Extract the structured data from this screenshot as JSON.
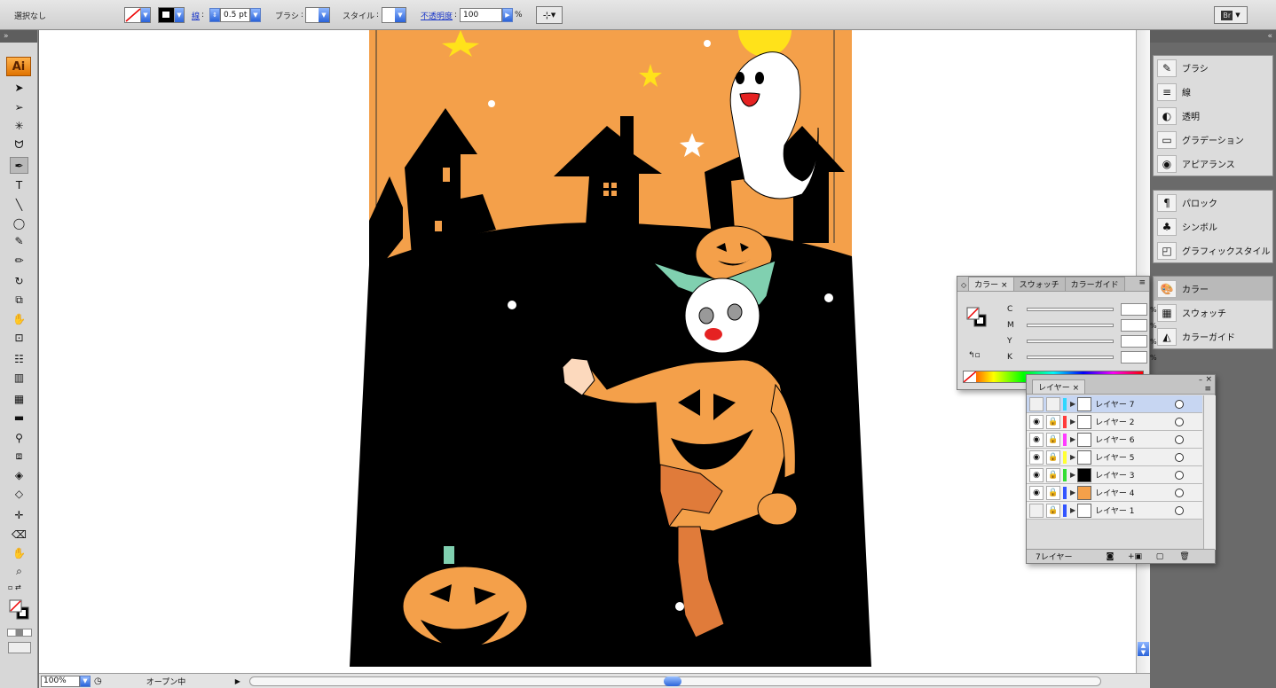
{
  "control_bar": {
    "selection_status": "選択なし",
    "stroke_label": "線",
    "stroke_weight": "0.5 pt",
    "brush_label": "ブラシ",
    "style_label": "スタイル",
    "opacity_label": "不透明度",
    "opacity_value": "100",
    "opacity_unit": "%",
    "bridge_label": "Br"
  },
  "toolbox": {
    "logo": "Ai",
    "tools": [
      {
        "icon": "selection-tool-icon",
        "glyph": "➤"
      },
      {
        "icon": "direct-selection-tool-icon",
        "glyph": "➢"
      },
      {
        "icon": "magic-wand-icon",
        "glyph": "✳"
      },
      {
        "icon": "lasso-icon",
        "glyph": "ᗢ"
      },
      {
        "icon": "pen-tool-icon",
        "glyph": "✒"
      },
      {
        "icon": "type-tool-icon",
        "glyph": "T"
      },
      {
        "icon": "line-tool-icon",
        "glyph": "╲"
      },
      {
        "icon": "ellipse-tool-icon",
        "glyph": "◯"
      },
      {
        "icon": "paintbrush-icon",
        "glyph": "✎"
      },
      {
        "icon": "pencil-icon",
        "glyph": "✏"
      },
      {
        "icon": "rotate-tool-icon",
        "glyph": "↻"
      },
      {
        "icon": "scale-tool-icon",
        "glyph": "⧉"
      },
      {
        "icon": "warp-tool-icon",
        "glyph": "✋"
      },
      {
        "icon": "free-transform-icon",
        "glyph": "⊡"
      },
      {
        "icon": "symbol-sprayer-icon",
        "glyph": "☷"
      },
      {
        "icon": "column-graph-icon",
        "glyph": "▥"
      },
      {
        "icon": "mesh-tool-icon",
        "glyph": "▦"
      },
      {
        "icon": "gradient-tool-icon",
        "glyph": "▬"
      },
      {
        "icon": "eyedropper-icon",
        "glyph": "⚲"
      },
      {
        "icon": "blend-tool-icon",
        "glyph": "⧈"
      },
      {
        "icon": "live-paint-bucket-icon",
        "glyph": "◈"
      },
      {
        "icon": "live-paint-selection-icon",
        "glyph": "◇"
      },
      {
        "icon": "slice-tool-icon",
        "glyph": "✛"
      },
      {
        "icon": "eraser-icon",
        "glyph": "⌫"
      },
      {
        "icon": "hand-tool-icon",
        "glyph": "✋"
      },
      {
        "icon": "zoom-tool-icon",
        "glyph": "⌕"
      }
    ]
  },
  "status_bar": {
    "zoom": "100%",
    "status": "オープン中"
  },
  "dock": {
    "group1": [
      {
        "label": "ブラシ",
        "icon": "brush-panel-icon",
        "glyph": "✎"
      },
      {
        "label": "線",
        "icon": "stroke-panel-icon",
        "glyph": "≡"
      },
      {
        "label": "透明",
        "icon": "transparency-panel-icon",
        "glyph": "◐"
      },
      {
        "label": "グラデーション",
        "icon": "gradient-panel-icon",
        "glyph": "▭"
      },
      {
        "label": "アピアランス",
        "icon": "appearance-panel-icon",
        "glyph": "◉"
      }
    ],
    "group2": [
      {
        "label": "パロック",
        "icon": "paragraph-style-icon",
        "glyph": "¶"
      },
      {
        "label": "シンボル",
        "icon": "symbols-panel-icon",
        "glyph": "♣"
      },
      {
        "label": "グラフィックスタイル",
        "icon": "graphic-styles-icon",
        "glyph": "◰"
      }
    ],
    "group3": [
      {
        "label": "カラー",
        "icon": "color-panel-icon",
        "glyph": "🎨"
      },
      {
        "label": "スウォッチ",
        "icon": "swatches-panel-icon",
        "glyph": "▦"
      },
      {
        "label": "カラーガイド",
        "icon": "color-guide-icon",
        "glyph": "◭"
      }
    ]
  },
  "color_panel": {
    "tabs": [
      "カラー",
      "スウォッチ",
      "カラーガイド"
    ],
    "channels": [
      "C",
      "M",
      "Y",
      "K"
    ],
    "percent": "%"
  },
  "layers_panel": {
    "tab": "レイヤー",
    "layers": [
      {
        "name": "レイヤー 7",
        "visible": false,
        "locked": false,
        "color": "#2fd7ff",
        "thumb": "#ffffff"
      },
      {
        "name": "レイヤー 2",
        "visible": true,
        "locked": true,
        "color": "#ff3b3b",
        "thumb": "#ffffff"
      },
      {
        "name": "レイヤー 6",
        "visible": true,
        "locked": true,
        "color": "#ff3bff",
        "thumb": "#ffffff"
      },
      {
        "name": "レイヤー 5",
        "visible": true,
        "locked": true,
        "color": "#ffff33",
        "thumb": "#ffffff"
      },
      {
        "name": "レイヤー 3",
        "visible": true,
        "locked": true,
        "color": "#33dd33",
        "thumb": "#000000"
      },
      {
        "name": "レイヤー 4",
        "visible": true,
        "locked": true,
        "color": "#3355ff",
        "thumb": "#f4a04a"
      },
      {
        "name": "レイヤー 1",
        "visible": false,
        "locked": true,
        "color": "#3355ff",
        "thumb": "#ffffff"
      }
    ],
    "footer_count": "7レイヤー"
  },
  "artwork": {
    "background_color": "#f4a04a",
    "silhouette_color": "#000000",
    "ghost_color": "#ffffff",
    "star_color": "#ffe21a",
    "hair_color": "#80d0b0"
  }
}
